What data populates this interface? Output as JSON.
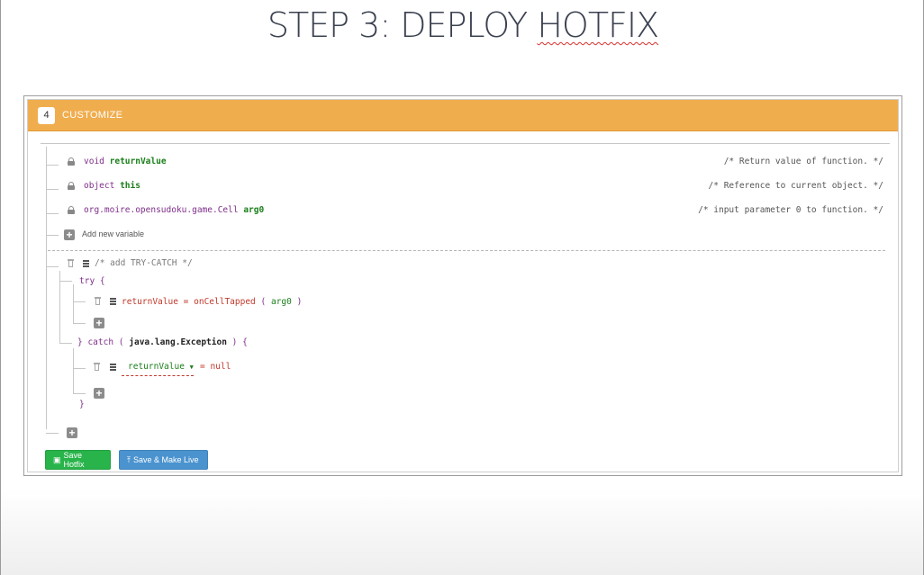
{
  "slide": {
    "title_plain": "STEP 3: DEPLOY ",
    "title_marked": "HOTFIX"
  },
  "panel": {
    "step_number": "4",
    "title": "CUSTOMIZE"
  },
  "variables": [
    {
      "type": "void",
      "name": "returnValue",
      "comment": "/* Return value of function. */"
    },
    {
      "type": "object",
      "name": "this",
      "comment": "/* Reference to current object. */"
    },
    {
      "type": "org.moire.opensudoku.game.Cell",
      "name": "arg0",
      "comment": "/* input parameter 0 to function. */"
    }
  ],
  "add_variable_label": "Add new variable",
  "code": {
    "block_comment": "/* add TRY-CATCH */",
    "try_open": "try {",
    "try_stmt": {
      "lhs": "returnValue",
      "op": "=",
      "call": "onCellTapped",
      "lparen": "(",
      "arg": "arg0",
      "rparen": ")"
    },
    "catch_prefix": "} catch",
    "catch_lparen": "(",
    "catch_type": "java.lang.Exception",
    "catch_suffix": ") {",
    "catch_stmt": {
      "select_value": "returnValue",
      "op": "=",
      "value": "null"
    },
    "close_brace": "}"
  },
  "buttons": {
    "save": "Save Hotfix",
    "save_live": "Save & Make Live"
  },
  "colors": {
    "header": "#f0ad4e",
    "save": "#28b44a",
    "save_live": "#4a93cf"
  },
  "icons": [
    "lock-icon",
    "plus-icon",
    "trash-icon",
    "menu-icon",
    "save-icon",
    "upload-icon"
  ]
}
